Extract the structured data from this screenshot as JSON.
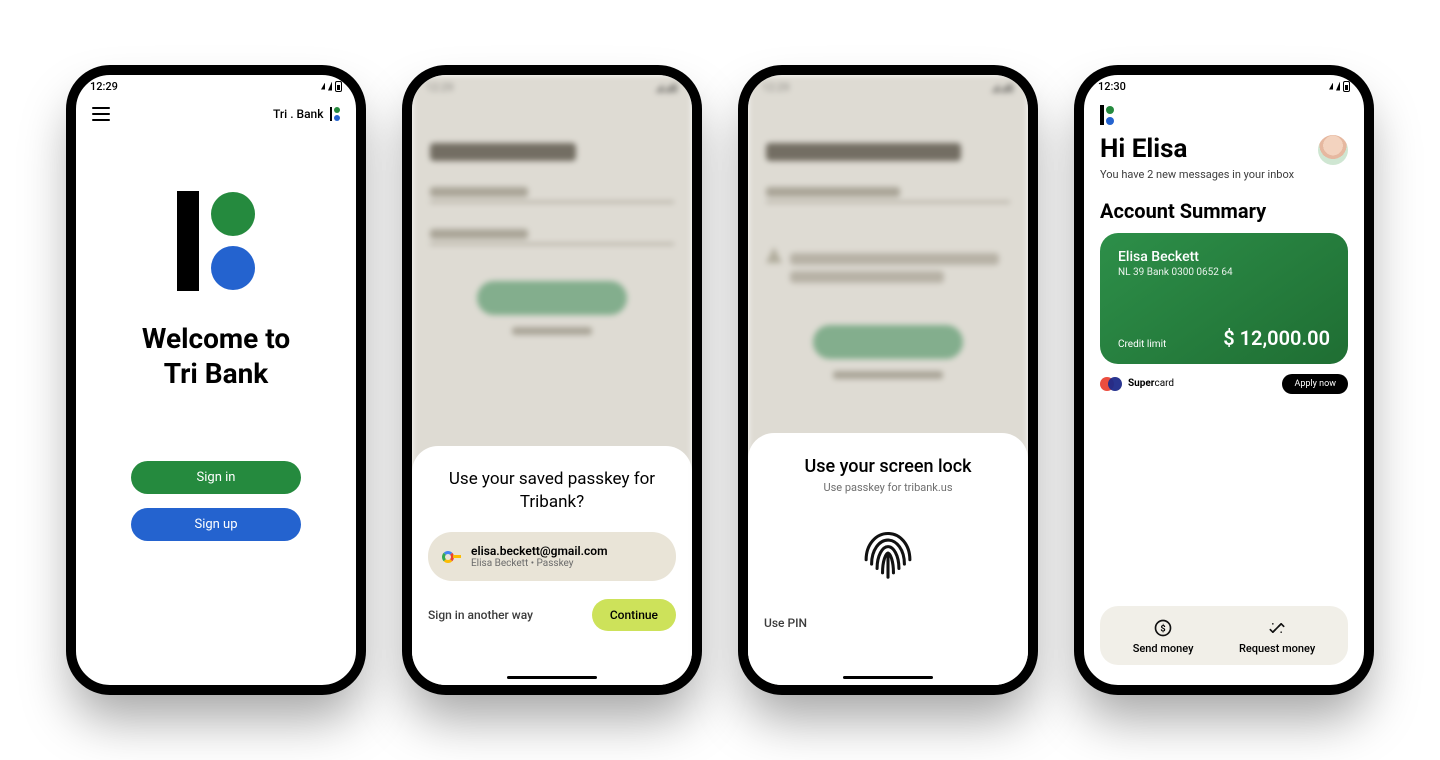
{
  "status": {
    "time_a": "12:29",
    "time_d": "12:30"
  },
  "brand": {
    "name": "Tri . Bank"
  },
  "screen1": {
    "title_line1": "Welcome to",
    "title_line2": "Tri Bank",
    "signin": "Sign in",
    "signup": "Sign up"
  },
  "screen2": {
    "bg_heading": "Sign in",
    "bg_label1": "Account name",
    "bg_label2": "Password",
    "bg_button": "Sign in",
    "bg_sub": "Create account",
    "sheet_title": "Use your saved passkey for Tribank?",
    "email": "elisa.beckett@gmail.com",
    "subtitle": "Elisa Beckett • Passkey",
    "alt_action": "Sign in another way",
    "continue": "Continue"
  },
  "screen3": {
    "bg_heading": "Create a new Tribank account",
    "bg_label1": "Your new Tribank username",
    "bg_button": "Sign up",
    "sheet_title": "Use your screen lock",
    "sheet_sub": "Use passkey for tribank.us",
    "use_pin": "Use PIN"
  },
  "screen4": {
    "greeting": "Hi Elisa",
    "inbox": "You have 2 new messages in your inbox",
    "section": "Account Summary",
    "card": {
      "name": "Elisa Beckett",
      "number": "NL 39 Bank 0300 0652 64",
      "limit_label": "Credit limit",
      "amount": "$ 12,000.00"
    },
    "supercard": {
      "brand_a": "Super",
      "brand_b": "card",
      "cta": "Apply now"
    },
    "actions": {
      "send": "Send money",
      "request": "Request money"
    }
  }
}
